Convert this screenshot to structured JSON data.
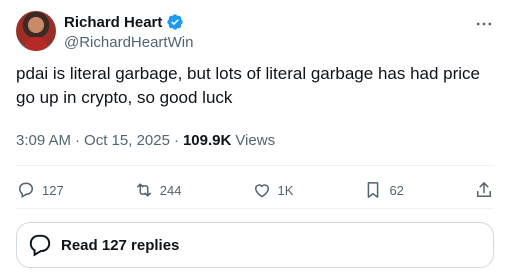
{
  "author": {
    "display_name": "Richard Heart",
    "handle": "@RichardHeartWin",
    "verified": true
  },
  "tweet": {
    "text": "pdai is literal garbage, but lots of literal garbage has had price go up in crypto, so good luck",
    "time": "3:09 AM",
    "date": "Oct 15, 2025",
    "views": "109.9K",
    "views_label": "Views"
  },
  "actions": {
    "replies": "127",
    "reposts": "244",
    "likes": "1K",
    "bookmarks": "62"
  },
  "read_replies_label": "Read 127 replies",
  "colors": {
    "text": "#0f1419",
    "secondary": "#536471",
    "verified": "#1d9bf0",
    "divider": "#eff3f4"
  }
}
